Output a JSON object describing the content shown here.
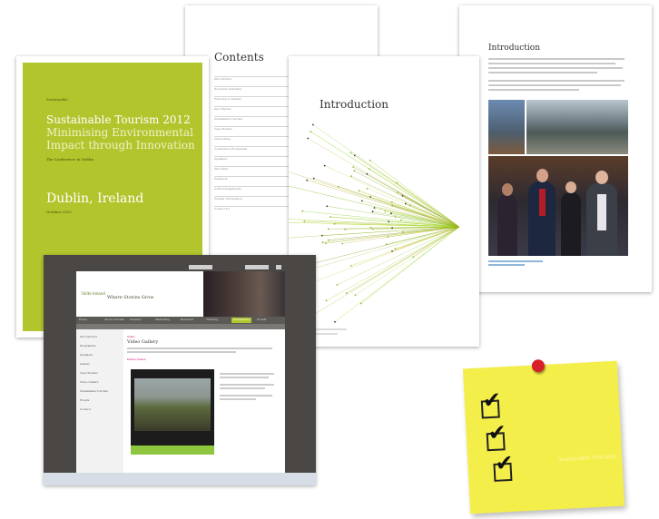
{
  "cover": {
    "kicker": "Sustainable",
    "title_line1": "Sustainable Tourism 2012",
    "title_line2": "Minimising Environmental Impact through Innovation",
    "subtitle": "The Conference in Dublin",
    "place": "Dublin, Ireland",
    "date": "October 2012"
  },
  "contents_page": {
    "heading": "Contents",
    "items": [
      "Introduction",
      "Executive Summary",
      "Welcome to Ireland",
      "Key Themes",
      "Sustainable Tourism",
      "Case Studies",
      "Networking",
      "Conference Programme",
      "Speakers",
      "Site Visits",
      "Feedback",
      "Acknowledgements",
      "Further Information",
      "Contact Us"
    ]
  },
  "intro_page": {
    "heading": "Introduction"
  },
  "right_page": {
    "heading": "Introduction"
  },
  "website": {
    "logo_text": "Fáilte Ireland",
    "tagline": "Where Stories Grow",
    "nav": [
      "Home",
      "About Tourism",
      "Industry",
      "Marketing",
      "Research",
      "Training",
      "Sustainable",
      "Events"
    ],
    "sidebar": [
      "Introduction",
      "Programme",
      "Speakers",
      "Gallery",
      "Case Studies",
      "Video Gallery",
      "Sustainable Tourism",
      "Events",
      "Contact"
    ],
    "page_label": "Video",
    "page_title": "Video Gallery",
    "section_link": "Dublin Videos",
    "colors": {
      "accent": "#b2c52d",
      "header": "#5c5a57",
      "link": "#cc0066"
    }
  },
  "sticky_note": {
    "faint_text": "Sustainable Checklist",
    "checkbox_count": 3
  }
}
